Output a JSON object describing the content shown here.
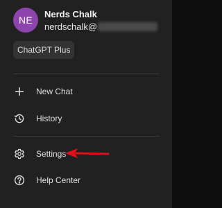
{
  "account": {
    "avatar_initials": "NE",
    "avatar_color": "#8e44ad",
    "name": "Nerds Chalk",
    "email_prefix": "nerdschalk@"
  },
  "plan": {
    "label": "ChatGPT Plus"
  },
  "menu": {
    "items": [
      {
        "label": "New Chat",
        "icon": "plus-icon"
      },
      {
        "label": "History",
        "icon": "history-icon"
      },
      {
        "label": "Settings",
        "icon": "gear-icon"
      },
      {
        "label": "Help Center",
        "icon": "help-icon"
      }
    ]
  },
  "colors": {
    "drawer_bg": "#212121",
    "annotation_arrow": "#e0101a"
  }
}
